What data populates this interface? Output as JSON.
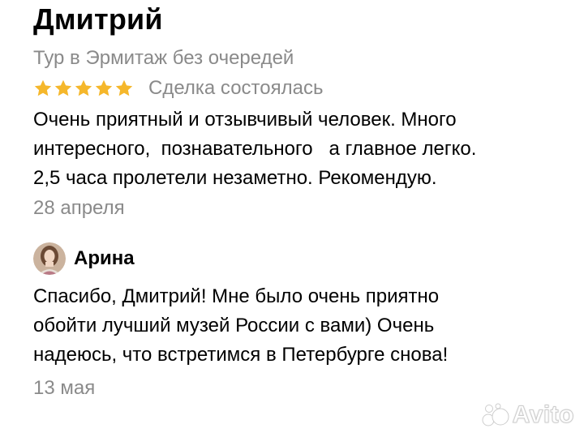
{
  "review": {
    "author": "Дмитрий",
    "item_title": "Тур в Эрмитаж без очередей",
    "rating": 5,
    "rating_max": 5,
    "deal_status": "Сделка состоялась",
    "text": "Очень приятный и отзывчивый человек. Много\nинтересного,  познавательного   а главное легко.\n2,5 часа пролетели незаметно. Рекомендую.",
    "date": "28 апреля"
  },
  "reply": {
    "author": "Арина",
    "text": "Спасибо, Дмитрий! Мне было очень приятно\nобойти лучший музей России с вами) Очень\nнадеюсь, что встретимся в Петербурге снова!",
    "date": "13 мая"
  },
  "watermark": {
    "text": "Avito",
    "icon": "avito-logo-icon"
  },
  "colors": {
    "star": "#f5b72b",
    "secondary_text": "#8a8a8a",
    "primary_text": "#000000",
    "background": "#ffffff"
  }
}
